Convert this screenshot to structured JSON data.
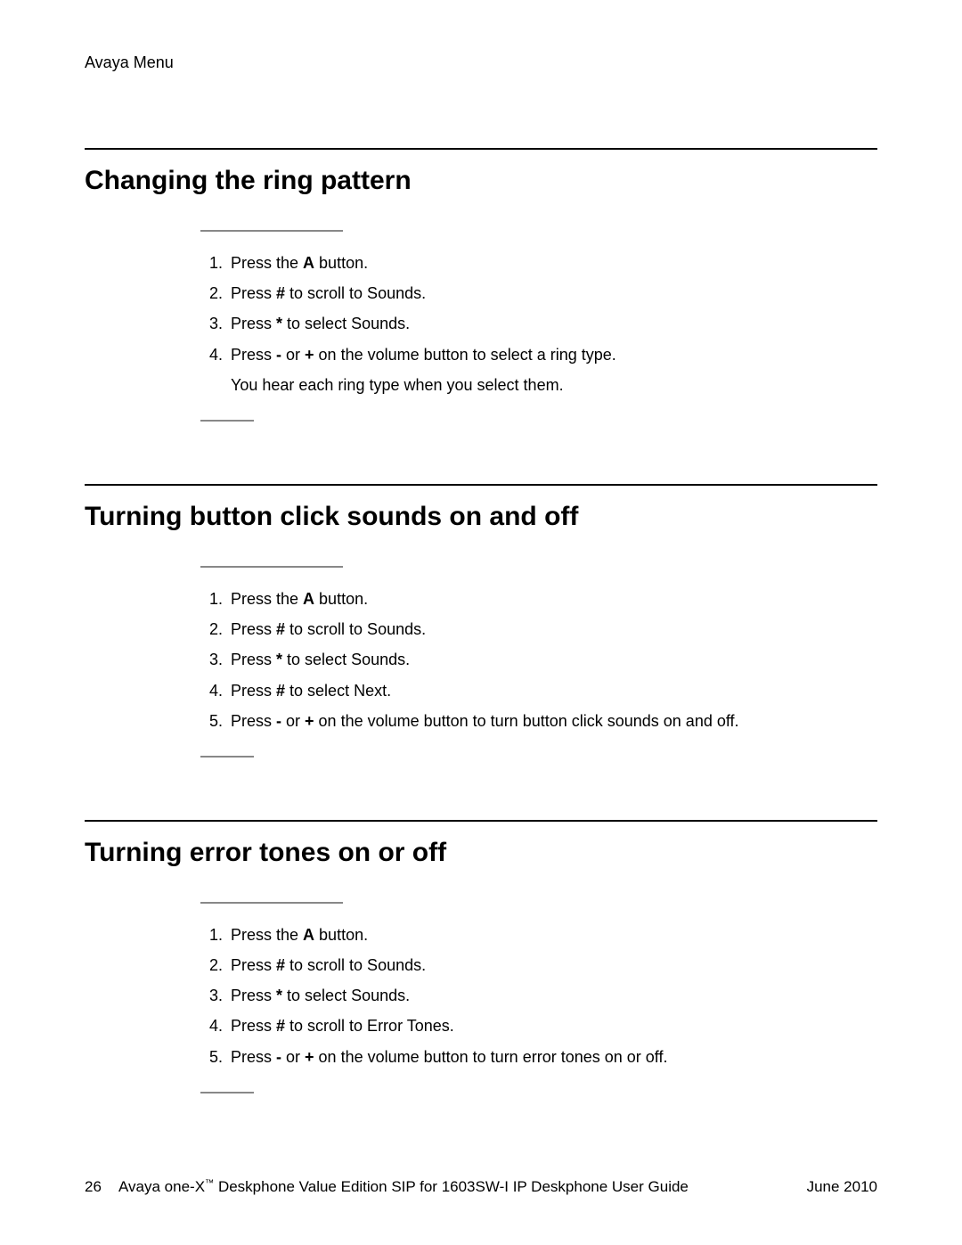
{
  "header": "Avaya Menu",
  "sections": [
    {
      "title": "Changing the ring pattern",
      "steps": [
        {
          "pre": "Press the ",
          "bold": "A",
          "post": " button."
        },
        {
          "pre": "Press ",
          "bold": "#",
          "post": " to scroll to Sounds."
        },
        {
          "pre": "Press ",
          "bold": "*",
          "post": " to select Sounds."
        },
        {
          "pre": "Press ",
          "bold": "-",
          "mid": " or ",
          "bold2": "+",
          "post": " on the volume button to select a ring type.",
          "note": "You hear each ring type when you select them."
        }
      ]
    },
    {
      "title": "Turning button click sounds on and off",
      "steps": [
        {
          "pre": "Press the ",
          "bold": "A",
          "post": " button."
        },
        {
          "pre": "Press ",
          "bold": "#",
          "post": " to scroll to Sounds."
        },
        {
          "pre": "Press ",
          "bold": "*",
          "post": " to select Sounds."
        },
        {
          "pre": "Press ",
          "bold": "#",
          "post": " to select Next."
        },
        {
          "pre": "Press ",
          "bold": "-",
          "mid": " or ",
          "bold2": "+",
          "post": " on the volume button to turn button click sounds on and off."
        }
      ]
    },
    {
      "title": "Turning error tones on or off",
      "steps": [
        {
          "pre": "Press the ",
          "bold": "A",
          "post": " button."
        },
        {
          "pre": "Press ",
          "bold": "#",
          "post": " to scroll to Sounds."
        },
        {
          "pre": "Press ",
          "bold": "*",
          "post": " to select Sounds."
        },
        {
          "pre": "Press ",
          "bold": "#",
          "post": " to scroll to Error Tones."
        },
        {
          "pre": "Press ",
          "bold": "-",
          "mid": " or ",
          "bold2": "+",
          "post": " on the volume button to turn error tones on or off."
        }
      ]
    }
  ],
  "footer": {
    "page": "26",
    "title_pre": "Avaya one-X",
    "title_tm": "™",
    "title_post": " Deskphone Value Edition SIP for 1603SW-I IP Deskphone User Guide",
    "date": "June 2010"
  }
}
